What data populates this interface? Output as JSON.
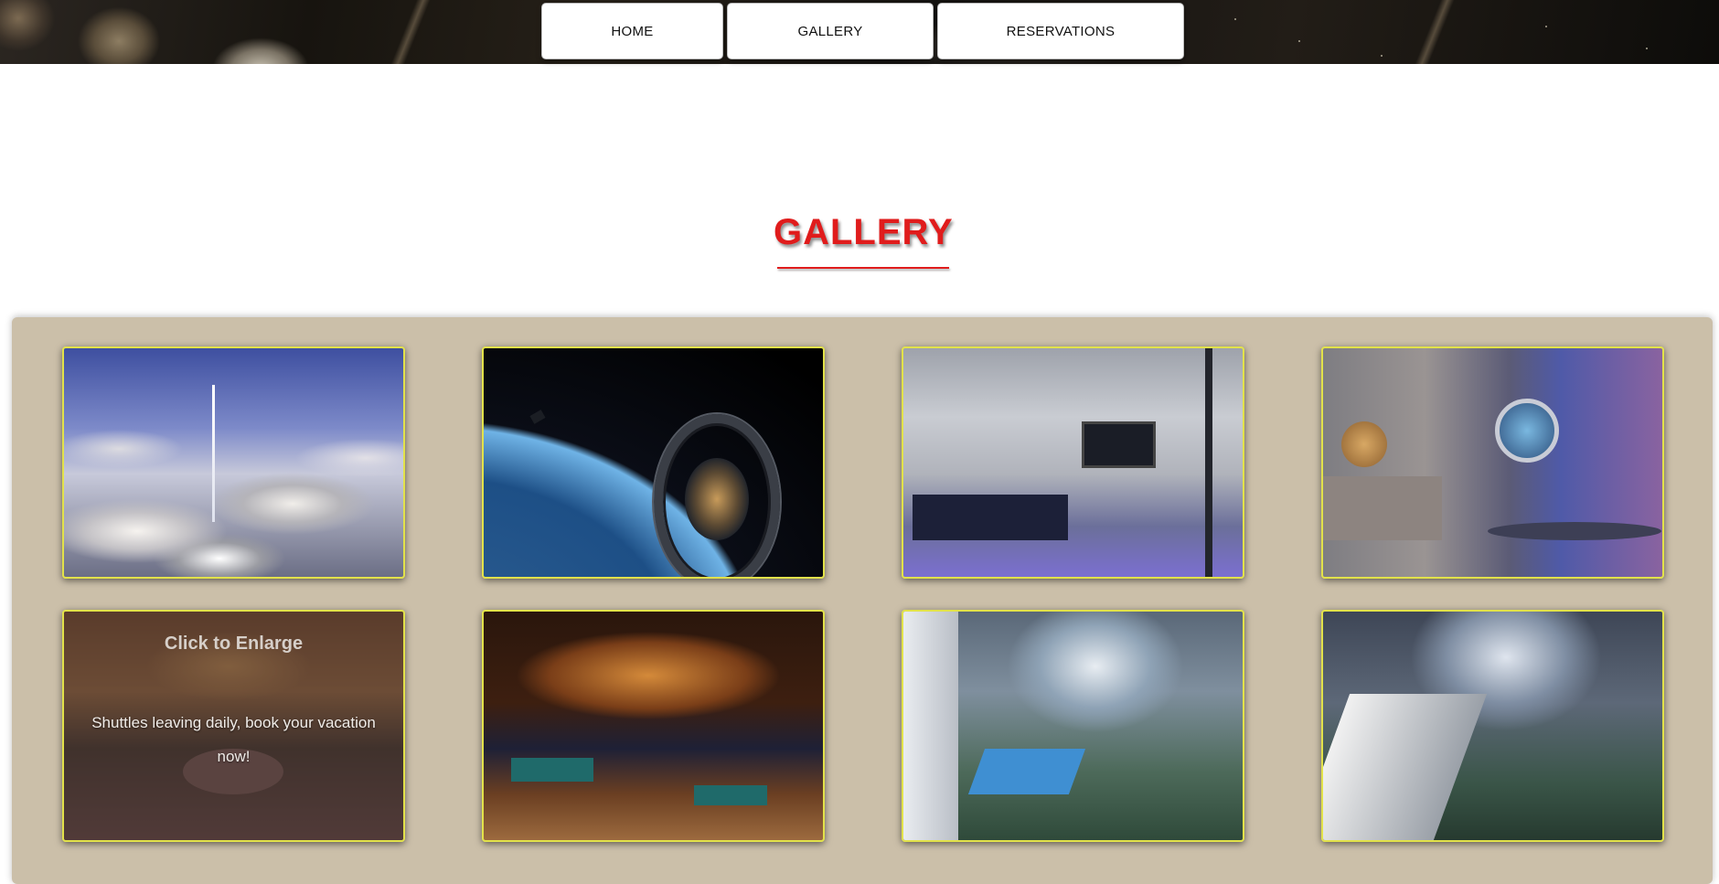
{
  "nav": {
    "items": [
      {
        "label": "HOME"
      },
      {
        "label": "GALLERY"
      },
      {
        "label": "RESERVATIONS"
      }
    ]
  },
  "page": {
    "title": "GALLERY"
  },
  "gallery": {
    "overlay": {
      "enlarge": "Click to Enlarge",
      "promo": "Shuttles leaving daily, book your vacation now!"
    },
    "tiles": [
      {
        "scene": "rocket launch above clouds"
      },
      {
        "scene": "ring space station orbiting earth"
      },
      {
        "scene": "futuristic sleeping quarters"
      },
      {
        "scene": "space themed hotel bedroom"
      },
      {
        "scene": "casino floor"
      },
      {
        "scene": "billiards hall"
      },
      {
        "scene": "habitat pool overlook"
      },
      {
        "scene": "habitat interior valley"
      }
    ]
  }
}
